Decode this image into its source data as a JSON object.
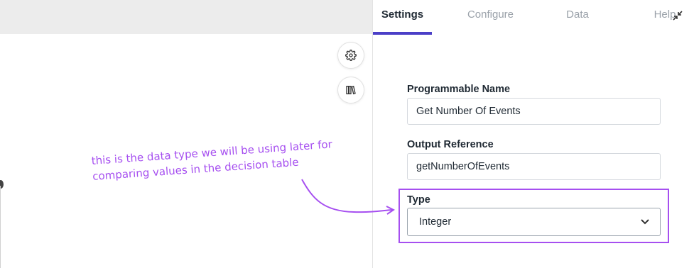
{
  "tabs": [
    {
      "label": "Settings",
      "active": true
    },
    {
      "label": "Configure",
      "active": false
    },
    {
      "label": "Data",
      "active": false
    },
    {
      "label": "Help",
      "active": false
    }
  ],
  "fields": {
    "programmable_name": {
      "label": "Programmable Name",
      "value": "Get Number Of Events"
    },
    "output_reference": {
      "label": "Output Reference",
      "value": "getNumberOfEvents"
    },
    "type": {
      "label": "Type",
      "selected": "Integer"
    }
  },
  "annotation": {
    "line1": "this is the data type we will be using later for",
    "line2": "comparing values in the decision table"
  },
  "icons": {
    "settings": "gear-icon",
    "library": "books-icon",
    "collapse": "collapse-arrows-icon",
    "dropdown": "chevron-down-icon"
  },
  "colors": {
    "accent": "#4b3fc7",
    "annotation": "#a64ff0"
  }
}
